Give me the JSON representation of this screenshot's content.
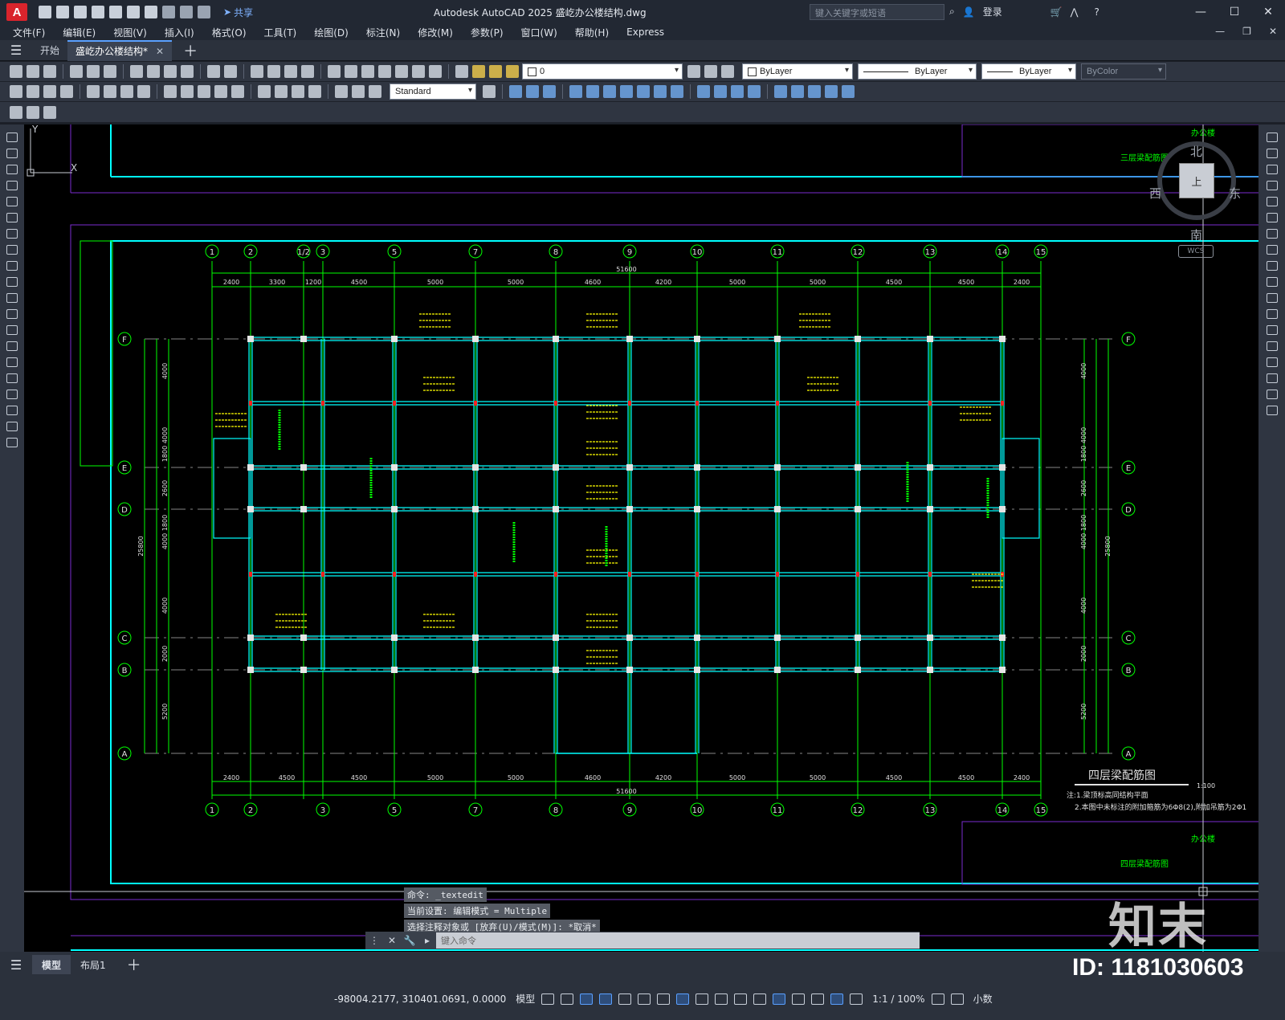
{
  "app": {
    "logo": "A",
    "title": "Autodesk AutoCAD 2025    盛屹办公楼结构.dwg",
    "share": "共享",
    "search_placeholder": "键入关键字或短语",
    "login": "登录"
  },
  "menu": [
    "文件(F)",
    "编辑(E)",
    "视图(V)",
    "插入(I)",
    "格式(O)",
    "工具(T)",
    "绘图(D)",
    "标注(N)",
    "修改(M)",
    "参数(P)",
    "窗口(W)",
    "帮助(H)",
    "Express"
  ],
  "tabs": {
    "start": "开始",
    "document": "盛屹办公楼结构*"
  },
  "toolbar": {
    "layer": "0",
    "text_style": "Standard",
    "color": "ByLayer",
    "linetype": "ByLayer",
    "lineweight": "ByLayer",
    "plotstyle": "ByColor"
  },
  "viewcube": {
    "north": "北",
    "south": "南",
    "east": "东",
    "west": "西",
    "top": "上",
    "wcs": "WCS"
  },
  "drawing": {
    "axes_top": [
      "1",
      "2",
      "1/2",
      "3",
      "5",
      "7",
      "8",
      "9",
      "10",
      "11",
      "12",
      "13",
      "14",
      "15"
    ],
    "axes_bottom": [
      "1",
      "2",
      "3",
      "5",
      "7",
      "8",
      "9",
      "10",
      "11",
      "12",
      "13",
      "14",
      "15"
    ],
    "rows_left": [
      "F",
      "E",
      "D",
      "C",
      "B",
      "A"
    ],
    "top_dims": [
      "2400",
      "3300",
      "1200",
      "4500",
      "5000",
      "5000",
      "4600",
      "4200",
      "5000",
      "5000",
      "4500",
      "4500",
      "2400"
    ],
    "bottom_dims": [
      "2400",
      "4500",
      "4500",
      "5000",
      "5000",
      "4600",
      "4200",
      "5000",
      "5000",
      "4500",
      "4500",
      "2400"
    ],
    "total_width": "51600",
    "total_height": "25800",
    "left_dims": [
      "4000",
      "4000",
      "1800",
      "2600",
      "1800",
      "4000",
      "4000",
      "2000",
      "5200"
    ],
    "sheet_title": "四层梁配筋图",
    "scale": "1:100",
    "note1": "注:1.梁顶标高同结构平面",
    "note2": "2.本图中未标注的附加箍筋为6Φ8(2),附加吊筋为2Φ1",
    "title_block_a": "三层梁配筋图",
    "title_block_b": "四层梁配筋图",
    "project": "办公楼"
  },
  "command": {
    "history": [
      "命令:  _textedit",
      "当前设置: 编辑模式 = Multiple",
      "选择注释对象或 [放弃(U)/模式(M)]: *取消*"
    ],
    "placeholder": "键入命令"
  },
  "layout_tabs": [
    "模型",
    "布局1"
  ],
  "status": {
    "coords": "-98004.2177, 310401.0691, 0.0000",
    "mode": "模型",
    "scale": "1:1 / 100%",
    "units": "小数"
  },
  "watermark": {
    "logo": "知末",
    "id": "ID: 1181030603"
  }
}
